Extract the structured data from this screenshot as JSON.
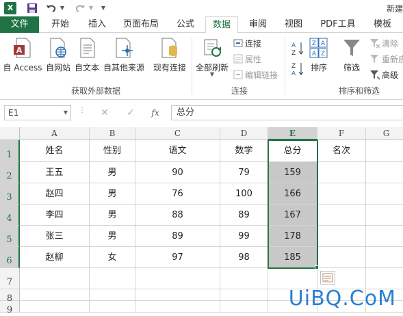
{
  "title_bar": {
    "app_logo": "X",
    "doc_title": "新建"
  },
  "tabs": [
    {
      "label": "文件"
    },
    {
      "label": "开始"
    },
    {
      "label": "插入"
    },
    {
      "label": "页面布局"
    },
    {
      "label": "公式"
    },
    {
      "label": "数据"
    },
    {
      "label": "审阅"
    },
    {
      "label": "视图"
    },
    {
      "label": "PDF工具"
    },
    {
      "label": "模板"
    }
  ],
  "active_tab": "数据",
  "ribbon": {
    "external": {
      "access": "自 Access",
      "web": "自网站",
      "text": "自文本",
      "other": "自其他来源",
      "existing": "现有连接",
      "group": "获取外部数据"
    },
    "connections": {
      "refresh": "全部刷新",
      "connect": "连接",
      "properties": "属性",
      "edit_links": "编辑链接",
      "group": "连接"
    },
    "sort": {
      "sort": "排序",
      "filter": "筛选",
      "clear": "清除",
      "reapply": "重新应",
      "advanced": "高级",
      "group": "排序和筛选"
    }
  },
  "formula_bar": {
    "name_box": "E1",
    "formula": "总分",
    "fx": "fx"
  },
  "columns": [
    "A",
    "B",
    "C",
    "D",
    "E",
    "F",
    "G"
  ],
  "rows": [
    "1",
    "2",
    "3",
    "4",
    "5",
    "6",
    "7",
    "8",
    "9"
  ],
  "table": {
    "headers": [
      "姓名",
      "性别",
      "语文",
      "数学",
      "总分",
      "名次"
    ],
    "data": [
      [
        "王五",
        "男",
        "90",
        "79",
        "159",
        ""
      ],
      [
        "赵四",
        "男",
        "76",
        "100",
        "166",
        ""
      ],
      [
        "李四",
        "男",
        "88",
        "89",
        "167",
        ""
      ],
      [
        "张三",
        "男",
        "89",
        "99",
        "178",
        ""
      ],
      [
        "赵柳",
        "女",
        "97",
        "98",
        "185",
        ""
      ]
    ]
  },
  "watermark": "UiBQ.CoM",
  "colors": {
    "excel_green": "#217346",
    "selection_fill": "#c8c8c8"
  }
}
